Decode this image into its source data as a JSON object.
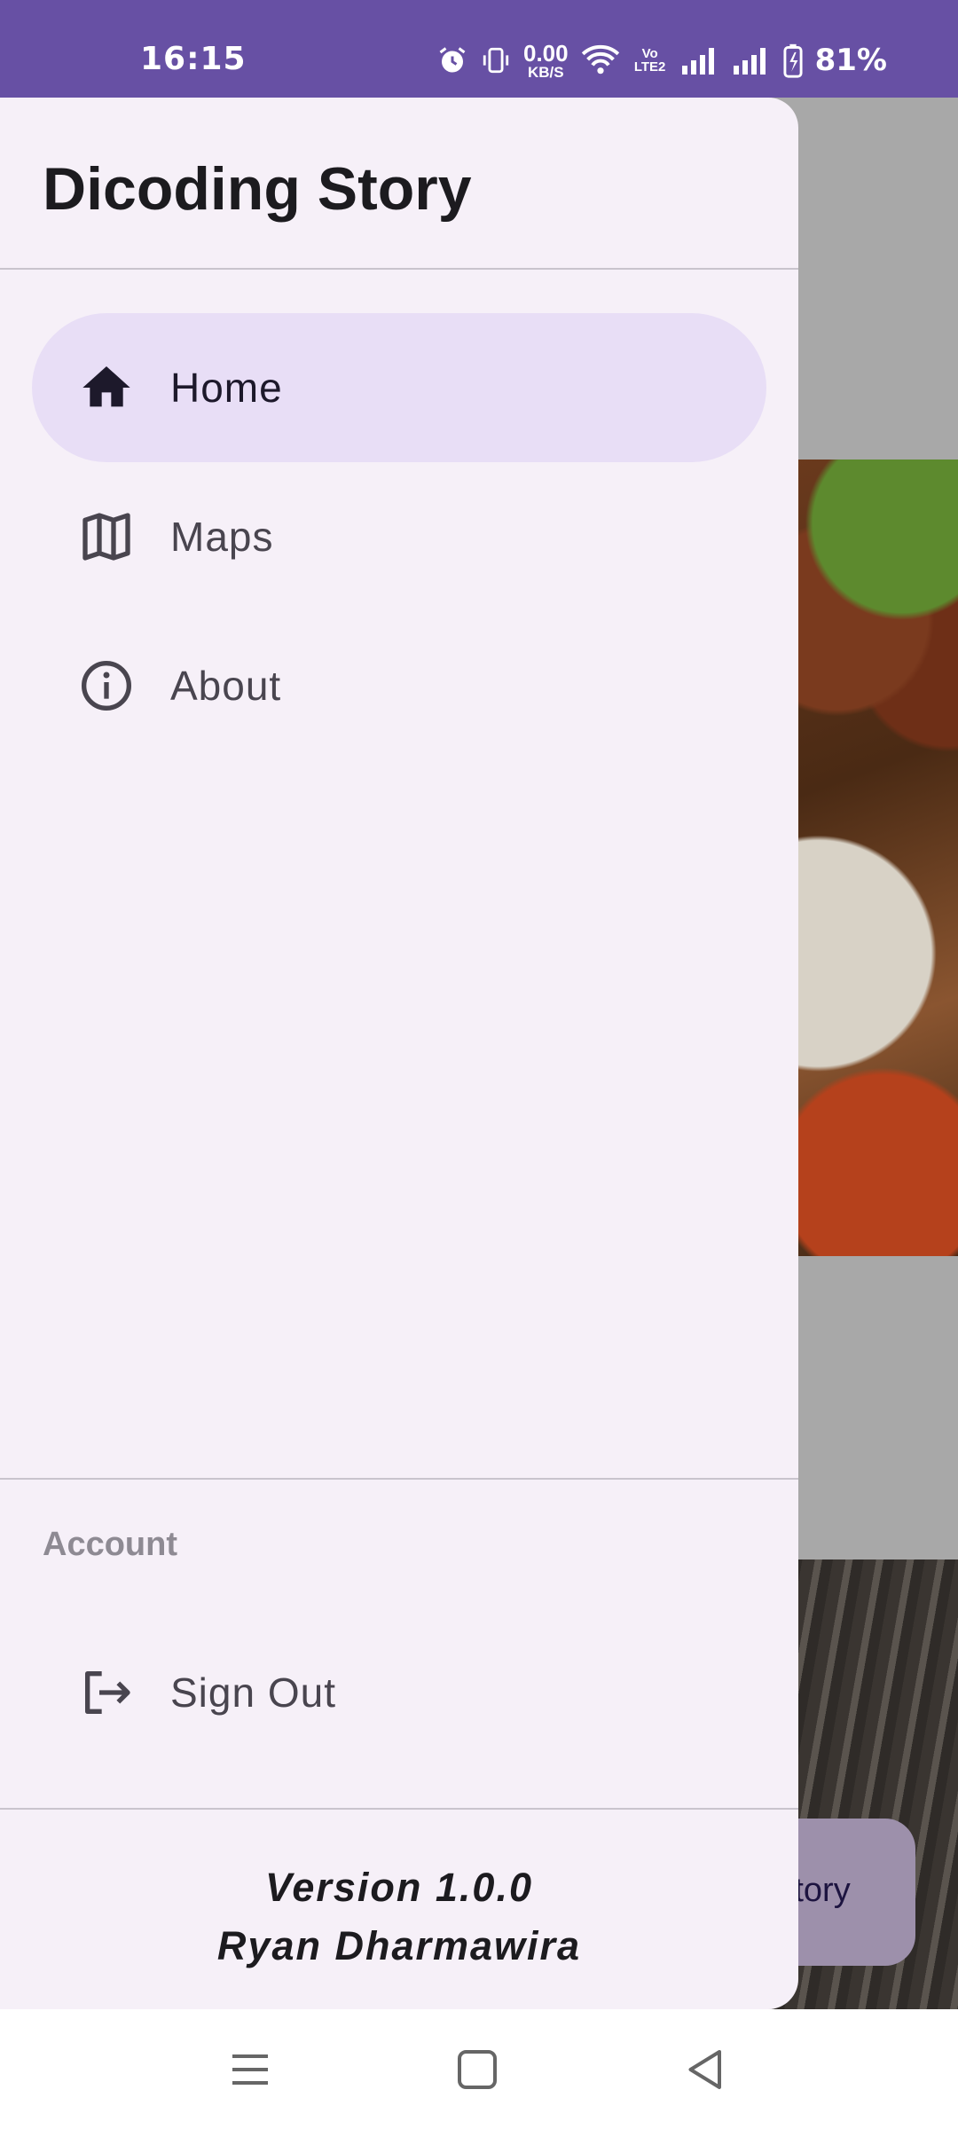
{
  "status_bar": {
    "time": "16:15",
    "net_speed_value": "0.00",
    "net_speed_unit": "KB/S",
    "volte_label": "Vo LTE2",
    "battery": "81%"
  },
  "drawer": {
    "title": "Dicoding Story",
    "items": [
      {
        "label": "Home",
        "icon": "home-icon",
        "active": true
      },
      {
        "label": "Maps",
        "icon": "map-icon",
        "active": false
      },
      {
        "label": "About",
        "icon": "info-icon",
        "active": false
      }
    ],
    "account_section": {
      "label": "Account",
      "items": [
        {
          "label": "Sign Out",
          "icon": "logout-icon"
        }
      ]
    },
    "footer": {
      "version": "Version 1.0.0",
      "author": "Ryan Dharmawira"
    }
  },
  "background_app": {
    "fab_label": "Story"
  },
  "colors": {
    "status_bar": "#6750A4",
    "drawer_bg": "#F6F0F8",
    "active_item": "#E8DEF6"
  }
}
